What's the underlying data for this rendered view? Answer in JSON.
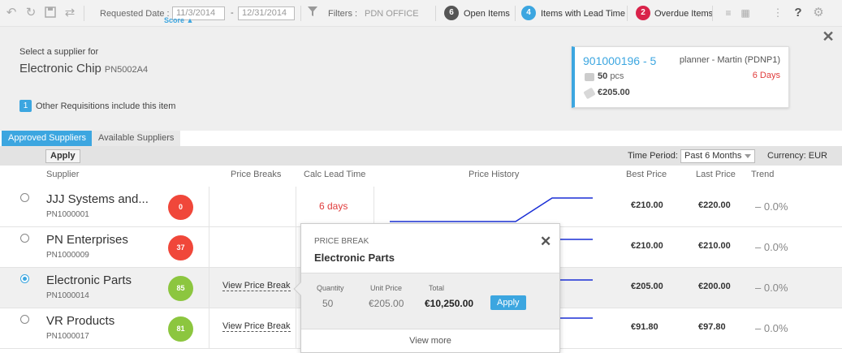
{
  "toolbar": {
    "requested_date_label": "Requested Date :",
    "date_from": "11/3/2014",
    "date_to_prefix": "-",
    "date_to": "12/31/2014",
    "filters_label": "Filters :",
    "filters_value": "PDN OFFICE",
    "open_items_count": "6",
    "open_items_label": "Open Items",
    "lead_time_count": "4",
    "lead_time_label": "Items with Lead Time",
    "overdue_count": "2",
    "overdue_label": "Overdue Items",
    "help": "?",
    "colors": {
      "dark": "#555555",
      "blue": "#3ca6e0",
      "red": "#d9234a"
    }
  },
  "header": {
    "select_label": "Select a supplier for",
    "item_name": "Electronic Chip",
    "item_pn": "PN5002A4",
    "other_req_count": "1",
    "other_req_text": "Other Requisitions include this item"
  },
  "requisition_card": {
    "id": "901000196 - 5",
    "planner": "planner - Martin (PDNP1)",
    "days": "6 Days",
    "qty": "50",
    "qty_unit": "pcs",
    "price": "€205.00"
  },
  "tabs": [
    {
      "label": "Approved Suppliers"
    },
    {
      "label": "Available Suppliers"
    }
  ],
  "filterbar": {
    "apply": "Apply",
    "time_period_label": "Time Period:",
    "time_period_value": "Past 6 Months",
    "currency": "Currency:  EUR"
  },
  "columns": {
    "supplier": "Supplier",
    "score": "Score ▲",
    "price_breaks": "Price Breaks",
    "calc_lead": "Calc Lead Time",
    "history": "Price History",
    "best": "Best Price",
    "last": "Last Price",
    "trend": "Trend"
  },
  "rows": [
    {
      "name": "JJJ Systems and...",
      "id": "PN1000001",
      "score": "0",
      "score_color": "#f0473a",
      "price_break": "",
      "lead": "6 days",
      "best": "€210.00",
      "last": "€220.00",
      "trend": "– 0.0%",
      "selected": false
    },
    {
      "name": "PN Enterprises",
      "id": "PN1000009",
      "score": "37",
      "score_color": "#f0473a",
      "price_break": "",
      "lead": "",
      "best": "€210.00",
      "last": "€210.00",
      "trend": "– 0.0%",
      "selected": false
    },
    {
      "name": "Electronic Parts",
      "id": "PN1000014",
      "score": "85",
      "score_color": "#8cc63f",
      "price_break": "View Price Break",
      "lead": "",
      "best": "€205.00",
      "last": "€200.00",
      "trend": "– 0.0%",
      "selected": true
    },
    {
      "name": "VR Products",
      "id": "PN1000017",
      "score": "81",
      "score_color": "#8cc63f",
      "price_break": "View Price Break",
      "lead": "",
      "best": "€91.80",
      "last": "€97.80",
      "trend": "– 0.0%",
      "selected": false
    }
  ],
  "popover": {
    "heading": "PRICE BREAK",
    "title": "Electronic Parts",
    "col_quantity": "Quantity",
    "col_unit_price": "Unit Price",
    "col_total": "Total",
    "quantity": "50",
    "unit_price": "€205.00",
    "total": "€10,250.00",
    "apply": "Apply",
    "view_more": "View more"
  }
}
